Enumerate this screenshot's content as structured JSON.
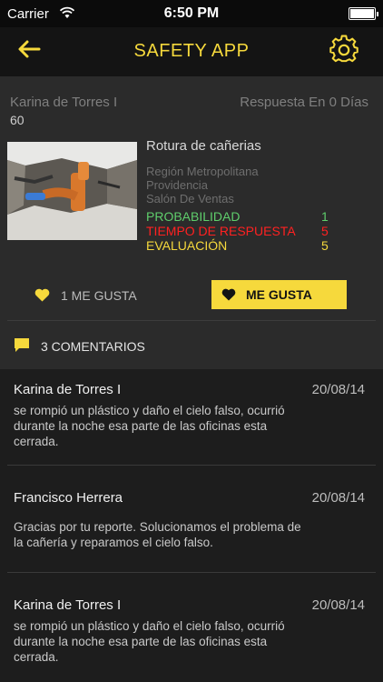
{
  "status_bar": {
    "carrier": "Carrier",
    "time": "6:50 PM"
  },
  "navbar": {
    "title": "SAFETY APP",
    "back_icon": "back-arrow-icon",
    "settings_icon": "gear-icon"
  },
  "report": {
    "author": "Karina de Torres I",
    "count": "60",
    "response": "Respuesta En 0 Días",
    "title": "Rotura de cañerias",
    "location": [
      "Región Metropolitana",
      "Providencia",
      "Salón De Ventas"
    ],
    "metrics": [
      {
        "label": "PROBABILIDAD",
        "value": "1",
        "color": "#5fce6c"
      },
      {
        "label": "TIEMPO DE RESPUESTA",
        "value": "5",
        "color": "#ff2121"
      },
      {
        "label": "EVALUACIÓN",
        "value": "5",
        "color": "#f6d93c"
      }
    ]
  },
  "likes": {
    "count_label": "1 ME GUSTA",
    "button_label": "ME GUSTA"
  },
  "comments_header": {
    "label": "3 COMENTARIOS"
  },
  "comments": [
    {
      "name": "Karina de Torres I",
      "date": "20/08/14",
      "lines": [
        "se rompió un plástico y daño el cielo falso, ocurrió",
        "durante la noche esa parte de las oficinas esta",
        "cerrada."
      ]
    },
    {
      "name": "Francisco Herrera",
      "date": "20/08/14",
      "lines": [
        "Gracias por tu reporte. Solucionamos el problema de",
        "la cañería y reparamos el cielo falso."
      ]
    },
    {
      "name": "Karina de Torres I",
      "date": "20/08/14",
      "lines": [
        "se rompió un plástico y daño el cielo falso, ocurrió",
        "durante la noche esa parte de las oficinas esta",
        "cerrada."
      ]
    }
  ],
  "colors": {
    "accent": "#f6d93c",
    "green": "#5fce6c",
    "red": "#ff2121"
  }
}
